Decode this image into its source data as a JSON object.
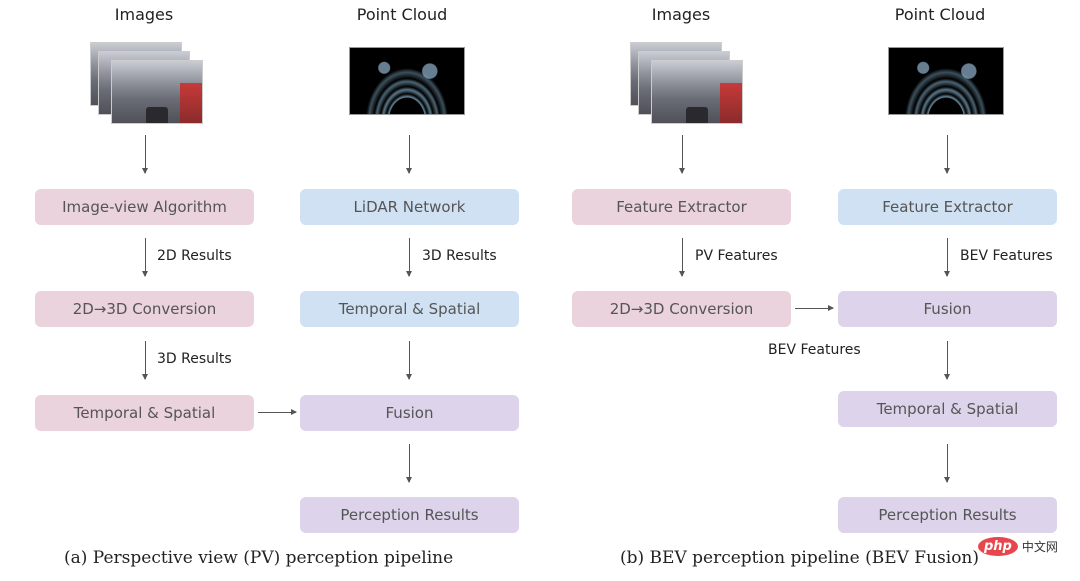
{
  "panel_a": {
    "headers": {
      "images": "Images",
      "point_cloud": "Point Cloud"
    },
    "boxes": {
      "image_view_algorithm": "Image-view Algorithm",
      "lidar_network": "LiDAR Network",
      "conversion": "2D→3D Conversion",
      "temporal_spatial_left": "Temporal & Spatial",
      "temporal_spatial_right": "Temporal & Spatial",
      "fusion": "Fusion",
      "perception_results": "Perception Results"
    },
    "edge_labels": {
      "results_2d": "2D Results",
      "results_3d_left": "3D Results",
      "results_3d_right": "3D Results"
    },
    "caption": "(a) Perspective view (PV) perception pipeline"
  },
  "panel_b": {
    "headers": {
      "images": "Images",
      "point_cloud": "Point Cloud"
    },
    "boxes": {
      "feature_extractor_left": "Feature Extractor",
      "feature_extractor_right": "Feature Extractor",
      "conversion": "2D→3D Conversion",
      "fusion": "Fusion",
      "temporal_spatial": "Temporal & Spatial",
      "perception_results": "Perception Results"
    },
    "edge_labels": {
      "pv_features": "PV Features",
      "bev_features_right": "BEV Features",
      "bev_features_left": "BEV Features"
    },
    "caption": "(b) BEV perception pipeline (BEV Fusion)"
  },
  "watermark": {
    "logo": "php",
    "text": "中文网"
  },
  "colors": {
    "camera_branch": "#ead3dc",
    "lidar_branch": "#cfe1f2",
    "fusion_branch": "#ddd3ea"
  }
}
